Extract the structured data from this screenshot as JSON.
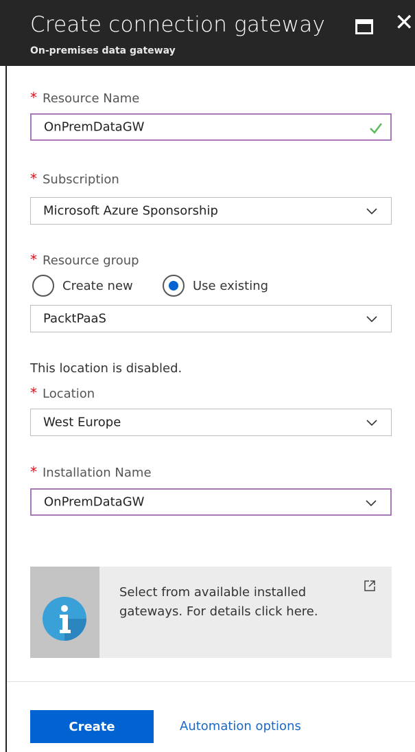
{
  "header": {
    "title": "Create connection gateway",
    "subtitle": "On-premises data gateway",
    "close_glyph": "✕"
  },
  "required_marker": "*",
  "fields": {
    "resource_name": {
      "label": "Resource Name",
      "value": "OnPremDataGW",
      "valid": true
    },
    "subscription": {
      "label": "Subscription",
      "value": "Microsoft Azure Sponsorship"
    },
    "resource_group": {
      "label": "Resource group",
      "options": [
        "Create new",
        "Use existing"
      ],
      "selected": "Use existing",
      "value": "PacktPaaS"
    },
    "location_note": "This location is disabled.",
    "location": {
      "label": "Location",
      "value": "West Europe"
    },
    "installation_name": {
      "label": "Installation Name",
      "value": "OnPremDataGW"
    }
  },
  "info_box": {
    "text": "Select from available installed gateways. For details click here.",
    "icon": "info-icon",
    "link_icon": "external-link-icon"
  },
  "footer": {
    "create_label": "Create",
    "automation_label": "Automation options"
  },
  "colors": {
    "header_bg": "#262626",
    "accent": "#0063d1",
    "required": "#e00b1c",
    "focus_border": "#a877b7",
    "valid_check": "#5cb85c"
  }
}
